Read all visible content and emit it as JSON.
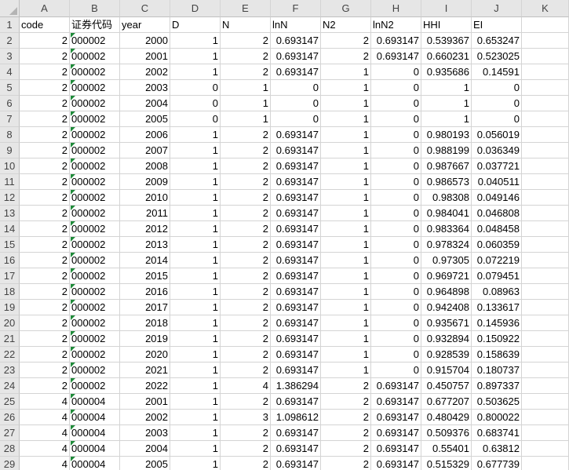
{
  "columns": [
    "A",
    "B",
    "C",
    "D",
    "E",
    "F",
    "G",
    "H",
    "I",
    "J",
    "K"
  ],
  "row_numbers": [
    1,
    2,
    3,
    4,
    5,
    6,
    7,
    8,
    9,
    10,
    11,
    12,
    13,
    14,
    15,
    16,
    17,
    18,
    19,
    20,
    21,
    22,
    23,
    24,
    25,
    26,
    27,
    28,
    29
  ],
  "header": [
    "code",
    "证券代码",
    "year",
    "D",
    "N",
    "lnN",
    "N2",
    "lnN2",
    "HHI",
    "EI"
  ],
  "rows": [
    [
      "2",
      "000002",
      "2000",
      "1",
      "2",
      "0.693147",
      "2",
      "0.693147",
      "0.539367",
      "0.653247"
    ],
    [
      "2",
      "000002",
      "2001",
      "1",
      "2",
      "0.693147",
      "2",
      "0.693147",
      "0.660231",
      "0.523025"
    ],
    [
      "2",
      "000002",
      "2002",
      "1",
      "2",
      "0.693147",
      "1",
      "0",
      "0.935686",
      "0.14591"
    ],
    [
      "2",
      "000002",
      "2003",
      "0",
      "1",
      "0",
      "1",
      "0",
      "1",
      "0"
    ],
    [
      "2",
      "000002",
      "2004",
      "0",
      "1",
      "0",
      "1",
      "0",
      "1",
      "0"
    ],
    [
      "2",
      "000002",
      "2005",
      "0",
      "1",
      "0",
      "1",
      "0",
      "1",
      "0"
    ],
    [
      "2",
      "000002",
      "2006",
      "1",
      "2",
      "0.693147",
      "1",
      "0",
      "0.980193",
      "0.056019"
    ],
    [
      "2",
      "000002",
      "2007",
      "1",
      "2",
      "0.693147",
      "1",
      "0",
      "0.988199",
      "0.036349"
    ],
    [
      "2",
      "000002",
      "2008",
      "1",
      "2",
      "0.693147",
      "1",
      "0",
      "0.987667",
      "0.037721"
    ],
    [
      "2",
      "000002",
      "2009",
      "1",
      "2",
      "0.693147",
      "1",
      "0",
      "0.986573",
      "0.040511"
    ],
    [
      "2",
      "000002",
      "2010",
      "1",
      "2",
      "0.693147",
      "1",
      "0",
      "0.98308",
      "0.049146"
    ],
    [
      "2",
      "000002",
      "2011",
      "1",
      "2",
      "0.693147",
      "1",
      "0",
      "0.984041",
      "0.046808"
    ],
    [
      "2",
      "000002",
      "2012",
      "1",
      "2",
      "0.693147",
      "1",
      "0",
      "0.983364",
      "0.048458"
    ],
    [
      "2",
      "000002",
      "2013",
      "1",
      "2",
      "0.693147",
      "1",
      "0",
      "0.978324",
      "0.060359"
    ],
    [
      "2",
      "000002",
      "2014",
      "1",
      "2",
      "0.693147",
      "1",
      "0",
      "0.97305",
      "0.072219"
    ],
    [
      "2",
      "000002",
      "2015",
      "1",
      "2",
      "0.693147",
      "1",
      "0",
      "0.969721",
      "0.079451"
    ],
    [
      "2",
      "000002",
      "2016",
      "1",
      "2",
      "0.693147",
      "1",
      "0",
      "0.964898",
      "0.08963"
    ],
    [
      "2",
      "000002",
      "2017",
      "1",
      "2",
      "0.693147",
      "1",
      "0",
      "0.942408",
      "0.133617"
    ],
    [
      "2",
      "000002",
      "2018",
      "1",
      "2",
      "0.693147",
      "1",
      "0",
      "0.935671",
      "0.145936"
    ],
    [
      "2",
      "000002",
      "2019",
      "1",
      "2",
      "0.693147",
      "1",
      "0",
      "0.932894",
      "0.150922"
    ],
    [
      "2",
      "000002",
      "2020",
      "1",
      "2",
      "0.693147",
      "1",
      "0",
      "0.928539",
      "0.158639"
    ],
    [
      "2",
      "000002",
      "2021",
      "1",
      "2",
      "0.693147",
      "1",
      "0",
      "0.915704",
      "0.180737"
    ],
    [
      "2",
      "000002",
      "2022",
      "1",
      "4",
      "1.386294",
      "2",
      "0.693147",
      "0.450757",
      "0.897337"
    ],
    [
      "4",
      "000004",
      "2001",
      "1",
      "2",
      "0.693147",
      "2",
      "0.693147",
      "0.677207",
      "0.503625"
    ],
    [
      "4",
      "000004",
      "2002",
      "1",
      "3",
      "1.098612",
      "2",
      "0.693147",
      "0.480429",
      "0.800022"
    ],
    [
      "4",
      "000004",
      "2003",
      "1",
      "2",
      "0.693147",
      "2",
      "0.693147",
      "0.509376",
      "0.683741"
    ],
    [
      "4",
      "000004",
      "2004",
      "1",
      "2",
      "0.693147",
      "2",
      "0.693147",
      "0.55401",
      "0.63812"
    ],
    [
      "4",
      "000004",
      "2005",
      "1",
      "2",
      "0.693147",
      "2",
      "0.693147",
      "0.515329",
      "0.677739"
    ]
  ],
  "colors": {
    "header_bg": "#e6e6e6",
    "grid": "#d4d4d4",
    "text_flag": "#1f8a3a"
  }
}
